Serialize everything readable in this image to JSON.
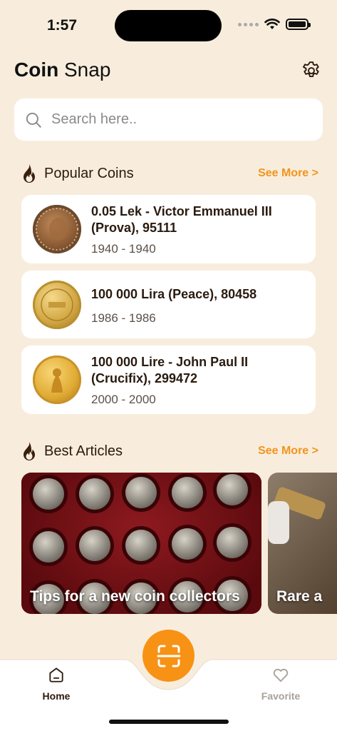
{
  "status_bar": {
    "time": "1:57"
  },
  "header": {
    "title_bold": "Coin",
    "title_regular": "Snap"
  },
  "search": {
    "placeholder": "Search here.."
  },
  "popular": {
    "title": "Popular Coins",
    "see_more": "See More >",
    "items": [
      {
        "name": "0.05 Lek - Victor Emmanuel III (Prova), 95111",
        "years": "1940 - 1940"
      },
      {
        "name": "100 000 Lira (Peace), 80458",
        "years": "1986 - 1986"
      },
      {
        "name": "100 000 Lire - John Paul II (Crucifix), 299472",
        "years": "2000 - 2000"
      }
    ]
  },
  "articles": {
    "title": "Best Articles",
    "see_more": "See More >",
    "items": [
      {
        "title": "Tips for a new coin collectors"
      },
      {
        "title": "Rare a"
      }
    ]
  },
  "bottom_nav": {
    "home_label": "Home",
    "favorite_label": "Favorite"
  },
  "colors": {
    "background": "#f8eddd",
    "accent": "#f79215",
    "see_more": "#f2941b",
    "text_dark": "#2a1a0e"
  }
}
